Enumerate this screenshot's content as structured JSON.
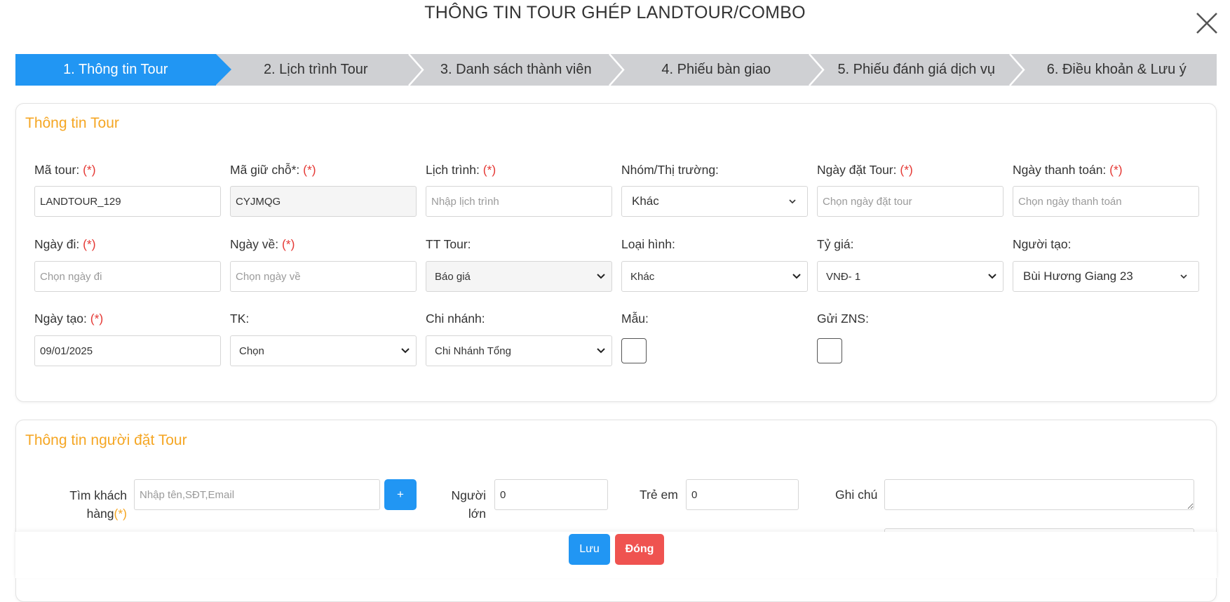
{
  "modal": {
    "title": "THÔNG TIN TOUR GHÉP LANDTOUR/COMBO"
  },
  "colors": {
    "primary": "#2196f3",
    "section_title": "#f5a623",
    "required": "#e53935",
    "danger": "#ef5350",
    "step_inactive": "#cfd0d3"
  },
  "steps": [
    {
      "label": "1. Thông tin Tour",
      "active": true
    },
    {
      "label": "2. Lịch trình Tour",
      "active": false
    },
    {
      "label": "3. Danh sách thành viên",
      "active": false
    },
    {
      "label": "4. Phiếu bàn giao",
      "active": false
    },
    {
      "label": "5. Phiếu đánh giá dịch vụ",
      "active": false
    },
    {
      "label": "6. Điều khoản & Lưu ý",
      "active": false
    }
  ],
  "tour_info": {
    "title": "Thông tin Tour",
    "required_mark": "(*)",
    "ma_tour": {
      "label": "Mã tour:",
      "value": "LANDTOUR_129"
    },
    "ma_giu_cho": {
      "label": "Mã giữ chỗ*:",
      "value": "CYJMQG"
    },
    "lich_trinh": {
      "label": "Lịch trình:",
      "placeholder": "Nhập lịch trình"
    },
    "nhom_thi_truong": {
      "label": "Nhóm/Thị trường:",
      "value": "Khác"
    },
    "ngay_dat_tour": {
      "label": "Ngày đặt Tour:",
      "placeholder": "Chọn ngày đặt tour"
    },
    "ngay_thanh_toan": {
      "label": "Ngày thanh toán:",
      "placeholder": "Chọn ngày thanh toán"
    },
    "ngay_di": {
      "label": "Ngày đi:",
      "placeholder": "Chọn ngày đi"
    },
    "ngay_ve": {
      "label": "Ngày về:",
      "placeholder": "Chọn ngày về"
    },
    "tt_tour": {
      "label": "TT Tour:",
      "value": "Báo giá"
    },
    "loai_hinh": {
      "label": "Loại hình:",
      "value": "Khác"
    },
    "ty_gia": {
      "label": "Tỷ giá:",
      "value": "VNĐ- 1"
    },
    "nguoi_tao": {
      "label": "Người tạo:",
      "value": "Bùi Hương Giang 23"
    },
    "ngay_tao": {
      "label": "Ngày tạo:",
      "value": "09/01/2025"
    },
    "tk": {
      "label": "TK:",
      "value": "Chọn"
    },
    "chi_nhanh": {
      "label": "Chi nhánh:",
      "value": "Chi Nhánh Tổng"
    },
    "mau": {
      "label": "Mẫu:",
      "checked": false
    },
    "gui_zns": {
      "label": "Gửi ZNS:",
      "checked": false
    }
  },
  "booker_info": {
    "title": "Thông tin người đặt Tour",
    "tim_khach_hang": {
      "label_line1": "Tìm khách",
      "label_line2": "hàng",
      "required_mark": "(*)",
      "placeholder": "Nhập tên,SĐT,Email",
      "add_label": "+"
    },
    "nguoi_lon": {
      "label_line1": "Người",
      "label_line2": "lớn",
      "value": "0"
    },
    "tre_em": {
      "label": "Trẻ em",
      "value": "0"
    },
    "ghi_chu": {
      "label": "Ghi chú",
      "value": ""
    }
  },
  "footer": {
    "save_label": "Lưu",
    "close_label": "Đóng"
  }
}
